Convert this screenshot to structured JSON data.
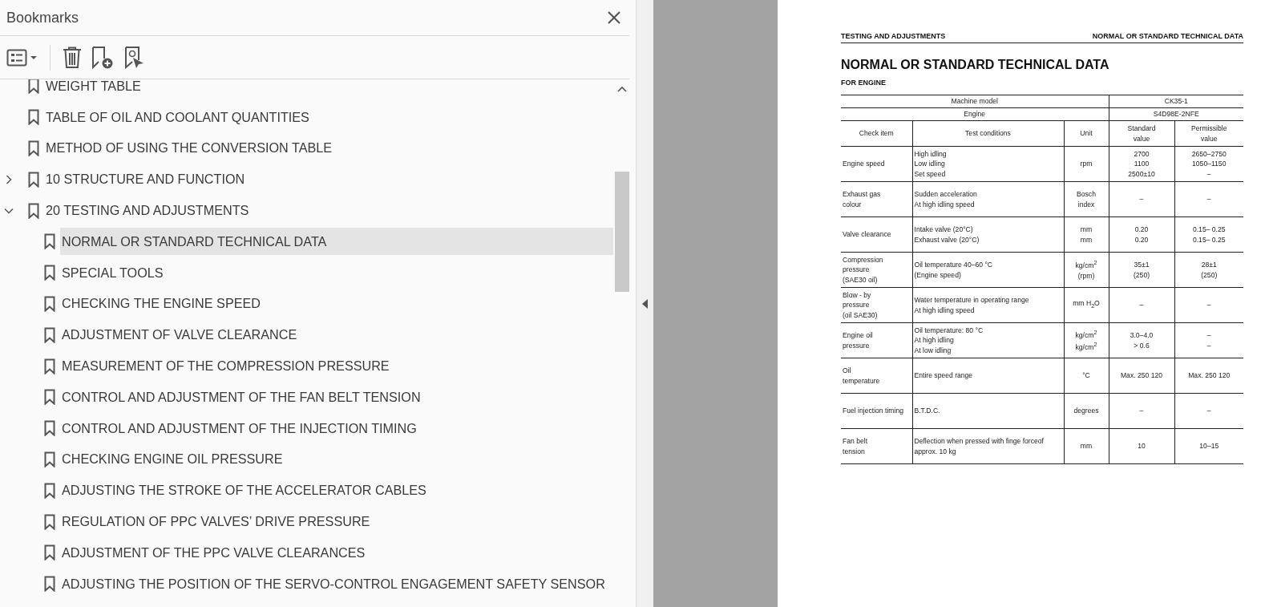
{
  "panel": {
    "title": "Bookmarks"
  },
  "bookmarks": [
    {
      "label": "WEIGHT TABLE",
      "selected": false
    },
    {
      "label": "TABLE OF OIL AND COOLANT QUANTITIES",
      "selected": false
    },
    {
      "label": "METHOD OF USING THE CONVERSION TABLE",
      "selected": false
    },
    {
      "label": "10 STRUCTURE AND FUNCTION",
      "selected": false,
      "expanded": false
    },
    {
      "label": "20 TESTING AND ADJUSTMENTS",
      "selected": false,
      "expanded": true,
      "children": [
        {
          "label": "NORMAL OR STANDARD TECHNICAL DATA",
          "selected": true
        },
        {
          "label": "SPECIAL TOOLS",
          "selected": false
        },
        {
          "label": "CHECKING THE ENGINE SPEED",
          "selected": false
        },
        {
          "label": "ADJUSTMENT OF VALVE CLEARANCE",
          "selected": false
        },
        {
          "label": "MEASUREMENT OF THE COMPRESSION PRESSURE",
          "selected": false
        },
        {
          "label": "CONTROL AND ADJUSTMENT OF THE FAN BELT TENSION",
          "selected": false
        },
        {
          "label": "CONTROL AND ADJUSTMENT OF THE INJECTION TIMING",
          "selected": false
        },
        {
          "label": "CHECKING ENGINE OIL PRESSURE",
          "selected": false
        },
        {
          "label": "ADJUSTING THE STROKE OF THE ACCELERATOR CABLES",
          "selected": false
        },
        {
          "label": "REGULATION OF PPC VALVES’ DRIVE PRESSURE",
          "selected": false
        },
        {
          "label": "ADJUSTMENT OF THE PPC VALVE CLEARANCES",
          "selected": false
        },
        {
          "label": "ADJUSTING THE POSITION OF THE SERVO-CONTROL ENGAGEMENT SAFETY SENSOR",
          "selected": false
        }
      ]
    }
  ],
  "document": {
    "header_left": "TESTING AND ADJUSTMENTS",
    "header_right": "NORMAL OR STANDARD TECHNICAL DATA",
    "title": "NORMAL OR STANDARD TECHNICAL DATA",
    "subtitle": "FOR ENGINE",
    "model_rows": [
      {
        "label": "Machine model",
        "value": "CK35-1"
      },
      {
        "label": "Engine",
        "value": "S4D98E-2NFE"
      }
    ],
    "columns": [
      "Check item",
      "Test conditions",
      "Unit",
      "Standard\nvalue",
      "Permissible\nvalue"
    ],
    "rows": [
      [
        "Engine speed",
        "High idling\nLow idling\nSet speed",
        "rpm",
        "2700\n1100\n2500±10",
        "2650–2750\n1050–1150\n–"
      ],
      [
        "Exhaust gas\ncolour",
        "Sudden acceleration\nAt high idling speed",
        "Bosch\nindex",
        "–",
        "–"
      ],
      [
        "Valve clearance",
        "Intake valve (20°C)\nExhaust valve (20°C)",
        "mm\nmm",
        "0.20\n0.20",
        "0.15– 0.25\n0.15– 0.25"
      ],
      [
        "Compression\npressure\n(SAE30 oil)",
        "Oil temperature 40–60 °C\n(Engine speed)",
        "kg/cm$^{2}$\n(rpm)",
        "35±1\n(250)",
        "28±1\n(250)"
      ],
      [
        "Blow - by\npressure\n(oil SAE30)",
        "Water temperature in operating range\nAt high idling speed",
        "mm H$_{2}$O",
        "–",
        "–"
      ],
      [
        "Engine oil\npressure",
        "Oil temperature: 80 °C\nAt high idling\nAt low idling",
        "kg/cm$^{2}$\nkg/cm$^{2}$",
        "3.0–4.0\n> 0.6",
        "–\n–"
      ],
      [
        "Oil\ntemperature",
        "Entire speed range",
        "°C",
        "Max. 250 120",
        "Max. 250 120"
      ],
      [
        "Fuel injection timing",
        "B.T.D.C.",
        "degrees",
        "–",
        "–"
      ],
      [
        "Fan belt\ntension",
        "Deflection when pressed with finge forceof\napprox. 10 kg",
        "mm",
        "10",
        "10–15"
      ]
    ]
  }
}
